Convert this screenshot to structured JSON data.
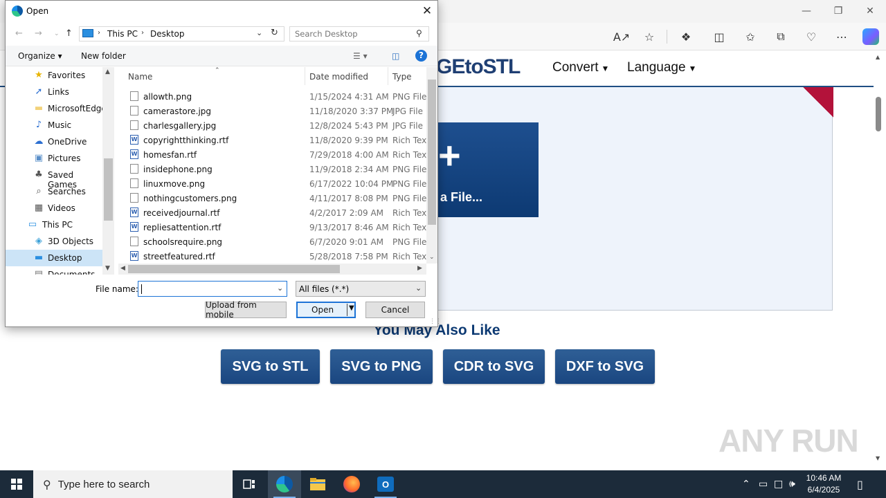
{
  "dialog": {
    "title": "Open",
    "address": {
      "crumbs": [
        "This PC",
        "Desktop"
      ]
    },
    "search_placeholder": "Search Desktop",
    "commands": {
      "organize": "Organize ▾",
      "new_folder": "New folder"
    },
    "nav_items": [
      {
        "label": "Favorites",
        "icon": "star-icon",
        "glyph": "★",
        "color": "#e8b400",
        "indent": 1
      },
      {
        "label": "Links",
        "icon": "link-icon",
        "glyph": "➚",
        "color": "#2c6fd1",
        "indent": 1
      },
      {
        "label": "MicrosoftEdge",
        "icon": "folder-icon",
        "glyph": "▬",
        "color": "#f2d27a",
        "indent": 1
      },
      {
        "label": "Music",
        "icon": "music-icon",
        "glyph": "♪",
        "color": "#2c6fd1",
        "indent": 1
      },
      {
        "label": "OneDrive",
        "icon": "cloud-icon",
        "glyph": "☁",
        "color": "#2c6fd1",
        "indent": 1
      },
      {
        "label": "Pictures",
        "icon": "pictures-icon",
        "glyph": "▣",
        "color": "#5a8fc9",
        "indent": 1
      },
      {
        "label": "Saved Games",
        "icon": "games-icon",
        "glyph": "♣",
        "color": "#555555",
        "indent": 1
      },
      {
        "label": "Searches",
        "icon": "search-icon",
        "glyph": "⌕",
        "color": "#555555",
        "indent": 1
      },
      {
        "label": "Videos",
        "icon": "video-icon",
        "glyph": "▦",
        "color": "#555555",
        "indent": 1
      },
      {
        "label": "This PC",
        "icon": "computer-icon",
        "glyph": "▭",
        "color": "#2b8fe0",
        "indent": 0
      },
      {
        "label": "3D Objects",
        "icon": "cube-icon",
        "glyph": "◈",
        "color": "#3aa0d8",
        "indent": 1
      },
      {
        "label": "Desktop",
        "icon": "desktop-icon",
        "glyph": "▬",
        "color": "#2b8fe0",
        "indent": 1,
        "selected": true
      },
      {
        "label": "Documents",
        "icon": "documents-icon",
        "glyph": "▤",
        "color": "#777777",
        "indent": 1
      }
    ],
    "columns": {
      "name": "Name",
      "date": "Date modified",
      "type": "Type"
    },
    "files": [
      {
        "name": "allowth.png",
        "date": "1/15/2024 4:31 AM",
        "type": "PNG File",
        "kind": "png"
      },
      {
        "name": "camerastore.jpg",
        "date": "11/18/2020 3:37 PM",
        "type": "JPG File",
        "kind": "png"
      },
      {
        "name": "charlesgallery.jpg",
        "date": "12/8/2024 5:43 PM",
        "type": "JPG File",
        "kind": "png"
      },
      {
        "name": "copyrightthinking.rtf",
        "date": "11/8/2020 9:39 PM",
        "type": "Rich Text",
        "kind": "rtf"
      },
      {
        "name": "homesfan.rtf",
        "date": "7/29/2018 4:00 AM",
        "type": "Rich Text",
        "kind": "rtf"
      },
      {
        "name": "insidephone.png",
        "date": "11/9/2018 2:34 AM",
        "type": "PNG File",
        "kind": "png"
      },
      {
        "name": "linuxmove.png",
        "date": "6/17/2022 10:04 PM",
        "type": "PNG File",
        "kind": "png"
      },
      {
        "name": "nothingcustomers.png",
        "date": "4/11/2017 8:08 PM",
        "type": "PNG File",
        "kind": "png"
      },
      {
        "name": "receivedjournal.rtf",
        "date": "4/2/2017 2:09 AM",
        "type": "Rich Text",
        "kind": "rtf"
      },
      {
        "name": "repliesattention.rtf",
        "date": "9/13/2017 8:46 AM",
        "type": "Rich Text",
        "kind": "rtf"
      },
      {
        "name": "schoolsrequire.png",
        "date": "6/7/2020 9:01 AM",
        "type": "PNG File",
        "kind": "png"
      },
      {
        "name": "streetfeatured.rtf",
        "date": "5/28/2018 7:58 PM",
        "type": "Rich Text",
        "kind": "rtf"
      }
    ],
    "file_name_label": "File name:",
    "file_name_value": "",
    "filter_value": "All files (*.*)",
    "upload_mobile_label": "Upload from mobile",
    "open_label": "Open",
    "cancel_label": "Cancel"
  },
  "site": {
    "logo": "GEtoSTL",
    "nav": [
      "Convert",
      "Language"
    ],
    "choose_label": "a File...",
    "also_title": "You May Also Like",
    "related": [
      "SVG to STL",
      "SVG to PNG",
      "CDR to SVG",
      "DXF to SVG"
    ],
    "watermark": "ANY RUN"
  },
  "taskbar": {
    "search_placeholder": "Type here to search",
    "time": "10:46 AM",
    "date": "6/4/2025"
  }
}
